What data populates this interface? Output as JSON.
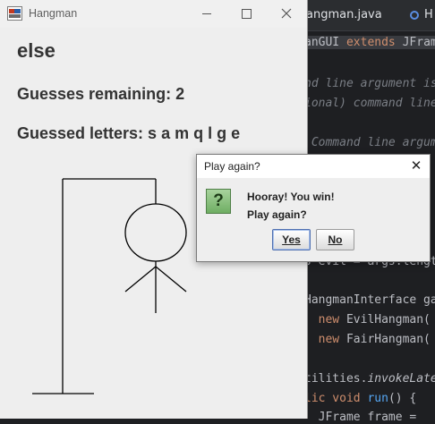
{
  "ide": {
    "tabs": [
      {
        "label": "angman.java"
      },
      {
        "label": "H"
      }
    ],
    "code_lines": [
      {
        "pre": "anGUI",
        "kw": " extends",
        "post": " JFram"
      },
      {
        "cm": "nd line argument is"
      },
      {
        "cm": "ional) command line"
      },
      {
        "cm": " Command line argum"
      },
      {
        "post": "s evil = args.length"
      },
      {
        "post": "HangmanInterface ga"
      },
      {
        "kw": "  new",
        "post": " EvilHangman("
      },
      {
        "kw": "  new",
        "post": " FairHangman("
      },
      {
        "post": "tilities.",
        "it": "invokeLate"
      },
      {
        "kw": "lic void",
        "fn": " run",
        "post": "() {"
      },
      {
        "post": "  JFrame frame = "
      }
    ]
  },
  "window": {
    "title": "Hangman",
    "icon": "java-app-icon",
    "controls": {
      "minimize": "minimize-icon",
      "maximize": "maximize-icon",
      "close": "close-icon"
    }
  },
  "game": {
    "word": "else",
    "remaining_text": "Guesses remaining: 2",
    "guessed_text": "Guessed letters: s a m q l g e",
    "guesses_remaining": 2,
    "guessed_letters": [
      "s",
      "a",
      "m",
      "q",
      "l",
      "g",
      "e"
    ]
  },
  "dialog": {
    "title": "Play again?",
    "icon": "question-icon",
    "icon_glyph": "?",
    "message_line1": "Hooray! You win!",
    "message_line2": "Play again?",
    "yes_label": "Yes",
    "no_label": "No",
    "close_glyph": "✕"
  }
}
